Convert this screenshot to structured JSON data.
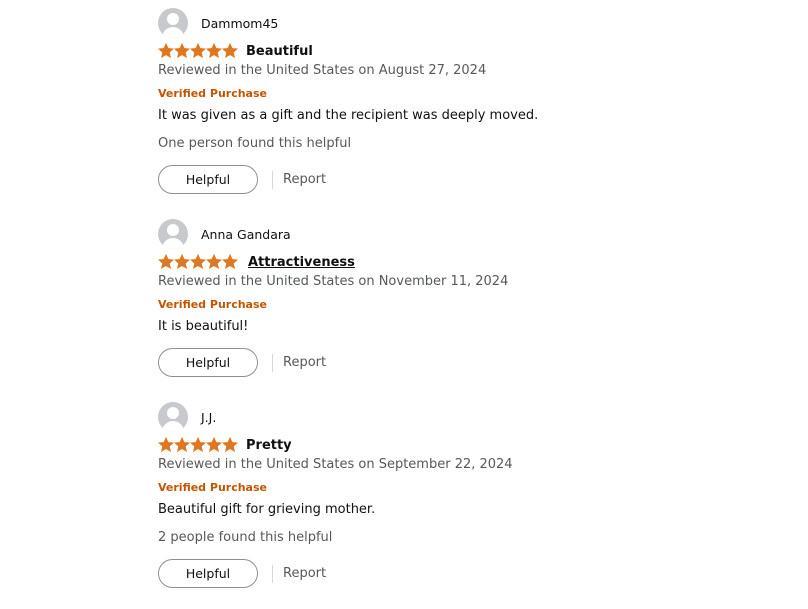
{
  "colors": {
    "star": "#de7921",
    "verified": "#c45500",
    "muted_text": "#565959",
    "primary_text": "#0f1111"
  },
  "reviews": [
    {
      "reviewer": "Dammom45",
      "rating": 5,
      "title": "Beautiful",
      "date": "Reviewed in the United States on August 27, 2024",
      "verified": "Verified Purchase",
      "body": "It was given as a gift and the recipient was deeply moved.",
      "helpful_count": "One person found this helpful",
      "helpful_label": "Helpful",
      "report_label": "Report"
    },
    {
      "reviewer": "Anna Gandara",
      "rating": 5,
      "title": "Attractiveness",
      "date": "Reviewed in the United States on November 11, 2024",
      "verified": "Verified Purchase",
      "body": "It is beautiful!",
      "helpful_label": "Helpful",
      "report_label": "Report"
    },
    {
      "reviewer": "J.J.",
      "rating": 5,
      "title": "Pretty",
      "date": "Reviewed in the United States on September 22, 2024",
      "verified": "Verified Purchase",
      "body": "Beautiful gift for grieving mother.",
      "helpful_count": "2 people found this helpful",
      "helpful_label": "Helpful",
      "report_label": "Report"
    }
  ]
}
